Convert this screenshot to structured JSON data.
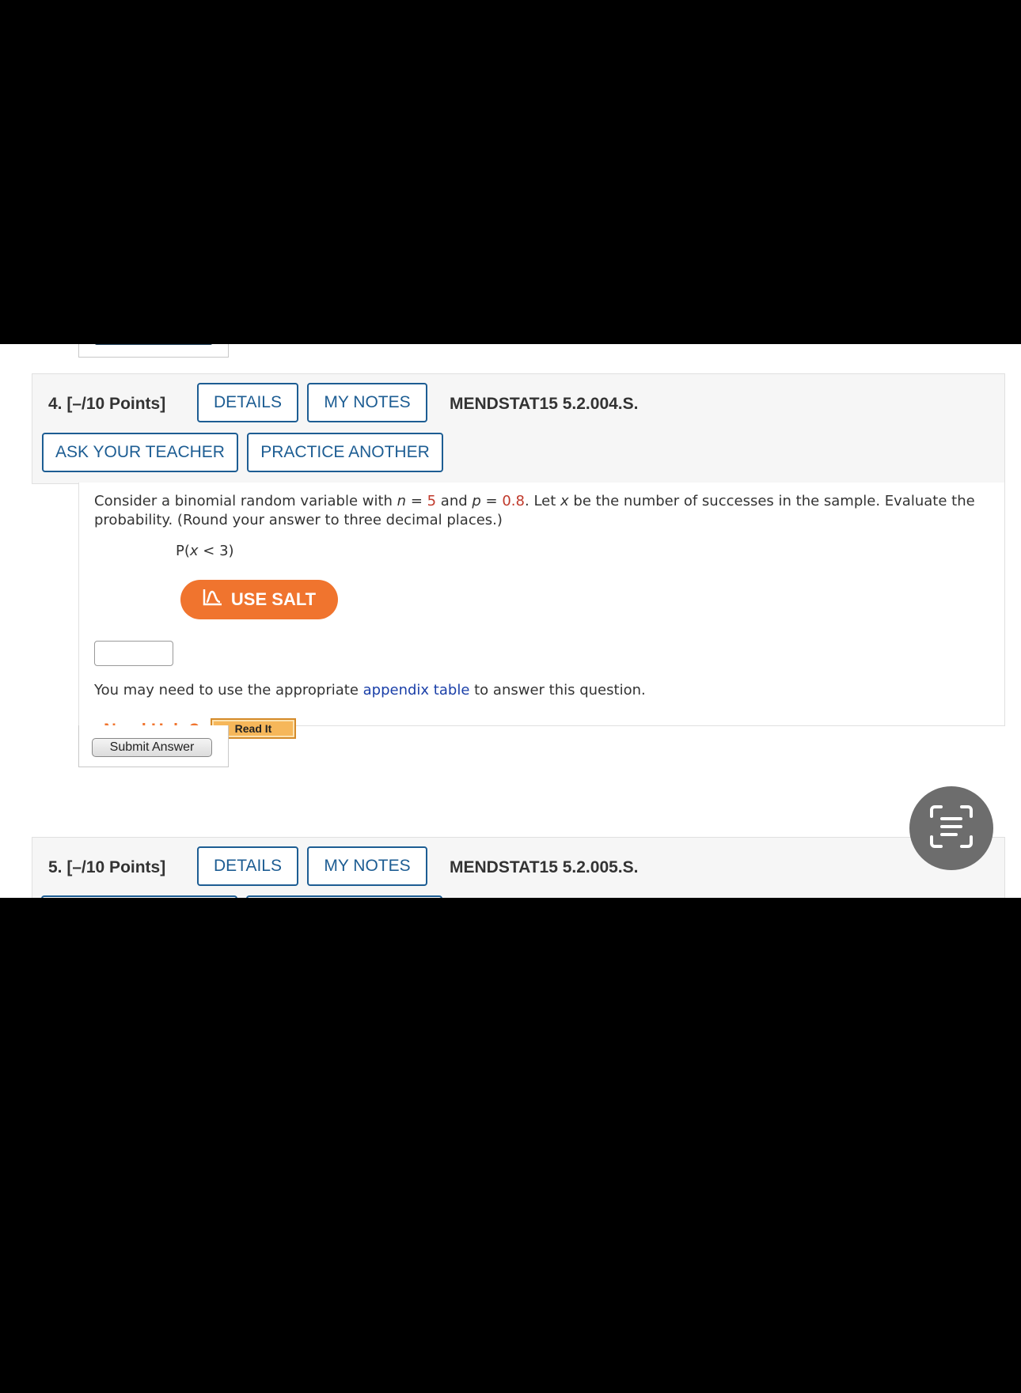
{
  "question4": {
    "number": "4.",
    "points": "[–/10 Points]",
    "details_label": "DETAILS",
    "my_notes_label": "MY NOTES",
    "code": "MENDSTAT15 5.2.004.S.",
    "ask_teacher_label": "ASK YOUR TEACHER",
    "practice_another_label": "PRACTICE ANOTHER",
    "text_part1": "Consider a binomial random variable with ",
    "n_var": "n",
    "eq1": " = ",
    "n_value": "5",
    "and_text": " and ",
    "p_var": "p",
    "eq2": " = ",
    "p_value": "0.8",
    "text_part2": ". Let ",
    "x_var": "x",
    "text_part3": " be the number of successes in the sample. Evaluate the probability. (Round your answer to three decimal places.)",
    "expression_prefix": "P(",
    "expression_var": "x",
    "expression_suffix": " < 3)",
    "use_salt_label": "USE SALT",
    "answer_value": "",
    "appendix_before": "You may need to use the appropriate ",
    "appendix_link": "appendix table",
    "appendix_after": " to answer this question.",
    "need_help_label": "Need Help?",
    "read_it_label": "Read It",
    "submit_label": "Submit Answer"
  },
  "question5": {
    "number": "5.",
    "points": "[–/10 Points]",
    "details_label": "DETAILS",
    "my_notes_label": "MY NOTES",
    "code": "MENDSTAT15 5.2.005.S."
  },
  "colors": {
    "accent_blue": "#1d5d93",
    "salt_orange": "#f0742e",
    "highlight_red": "#c0392b",
    "link_blue": "#1a3fa8"
  },
  "icons": {
    "salt": "salt-chart-icon",
    "scan": "text-scan-icon"
  }
}
